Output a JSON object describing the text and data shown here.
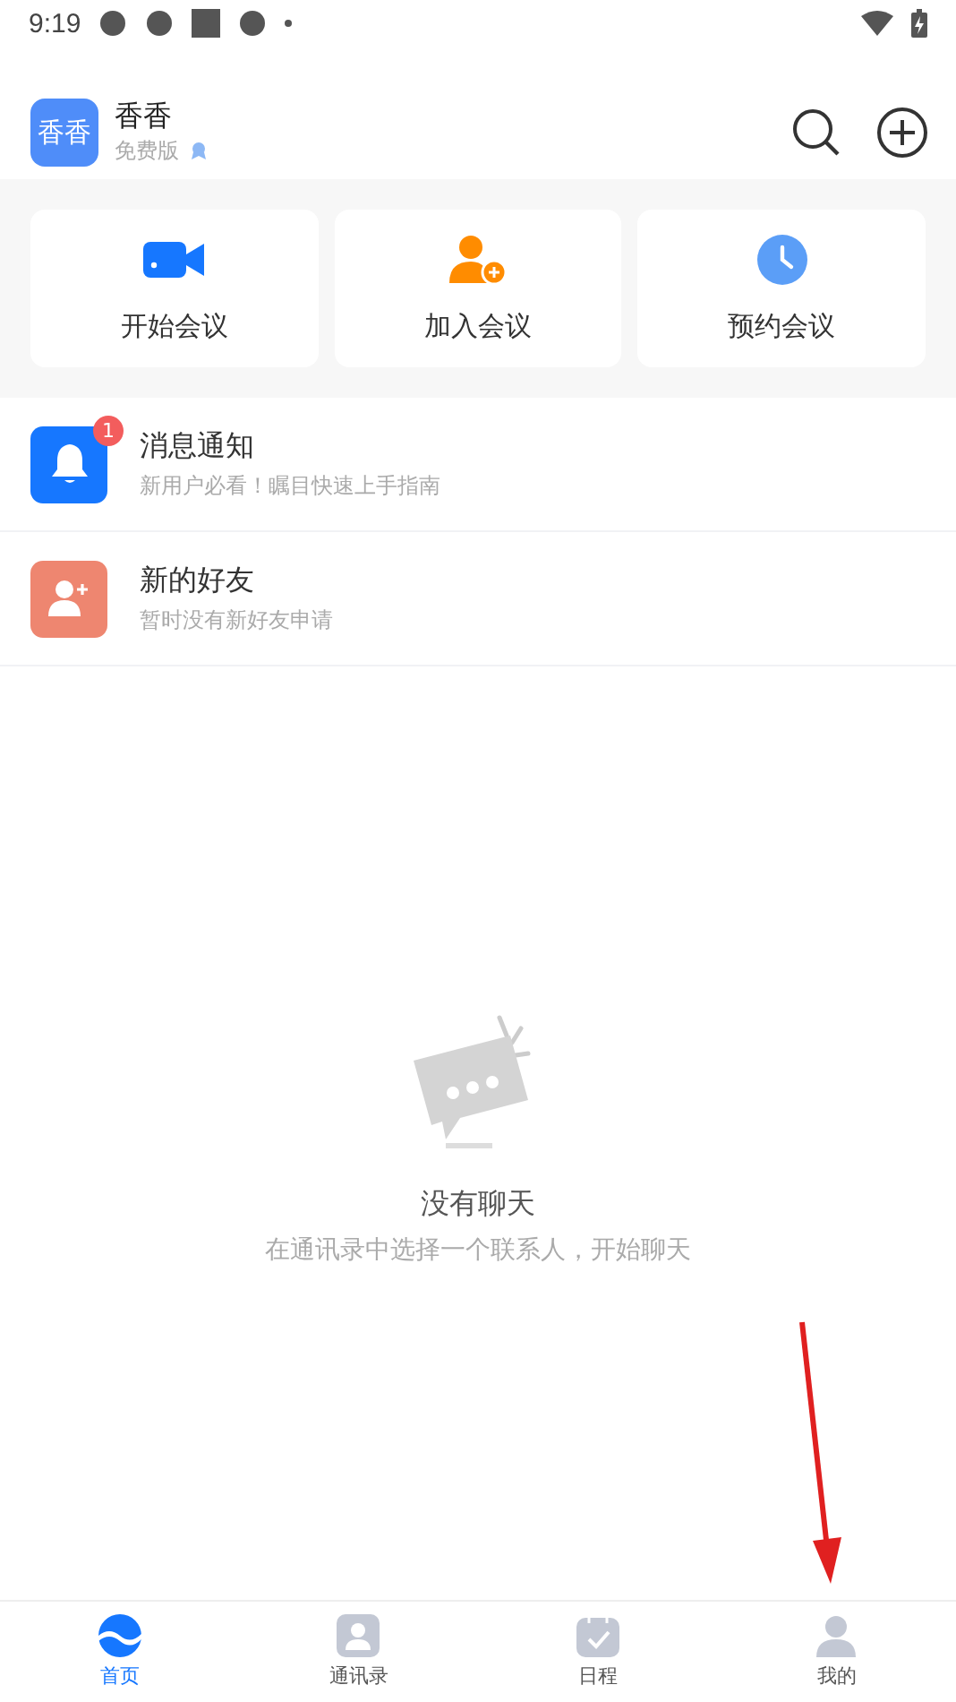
{
  "status_bar": {
    "time": "9:19"
  },
  "header": {
    "avatar_text": "香香",
    "name": "香香",
    "plan": "免费版"
  },
  "quick_actions": [
    {
      "kind": "video",
      "label": "开始会议"
    },
    {
      "kind": "join",
      "label": "加入会议"
    },
    {
      "kind": "schedule",
      "label": "预约会议"
    }
  ],
  "list": [
    {
      "kind": "notice",
      "title": "消息通知",
      "subtitle": "新用户必看！瞩目快速上手指南",
      "badge": "1"
    },
    {
      "kind": "friend",
      "title": "新的好友",
      "subtitle": "暂时没有新好友申请"
    }
  ],
  "empty_state": {
    "title": "没有聊天",
    "hint": "在通讯录中选择一个联系人，开始聊天"
  },
  "tabs": [
    {
      "kind": "home",
      "label": "首页",
      "selected": true
    },
    {
      "kind": "contacts",
      "label": "通讯录",
      "selected": false
    },
    {
      "kind": "calendar",
      "label": "日程",
      "selected": false
    },
    {
      "kind": "me",
      "label": "我的",
      "selected": false
    }
  ]
}
